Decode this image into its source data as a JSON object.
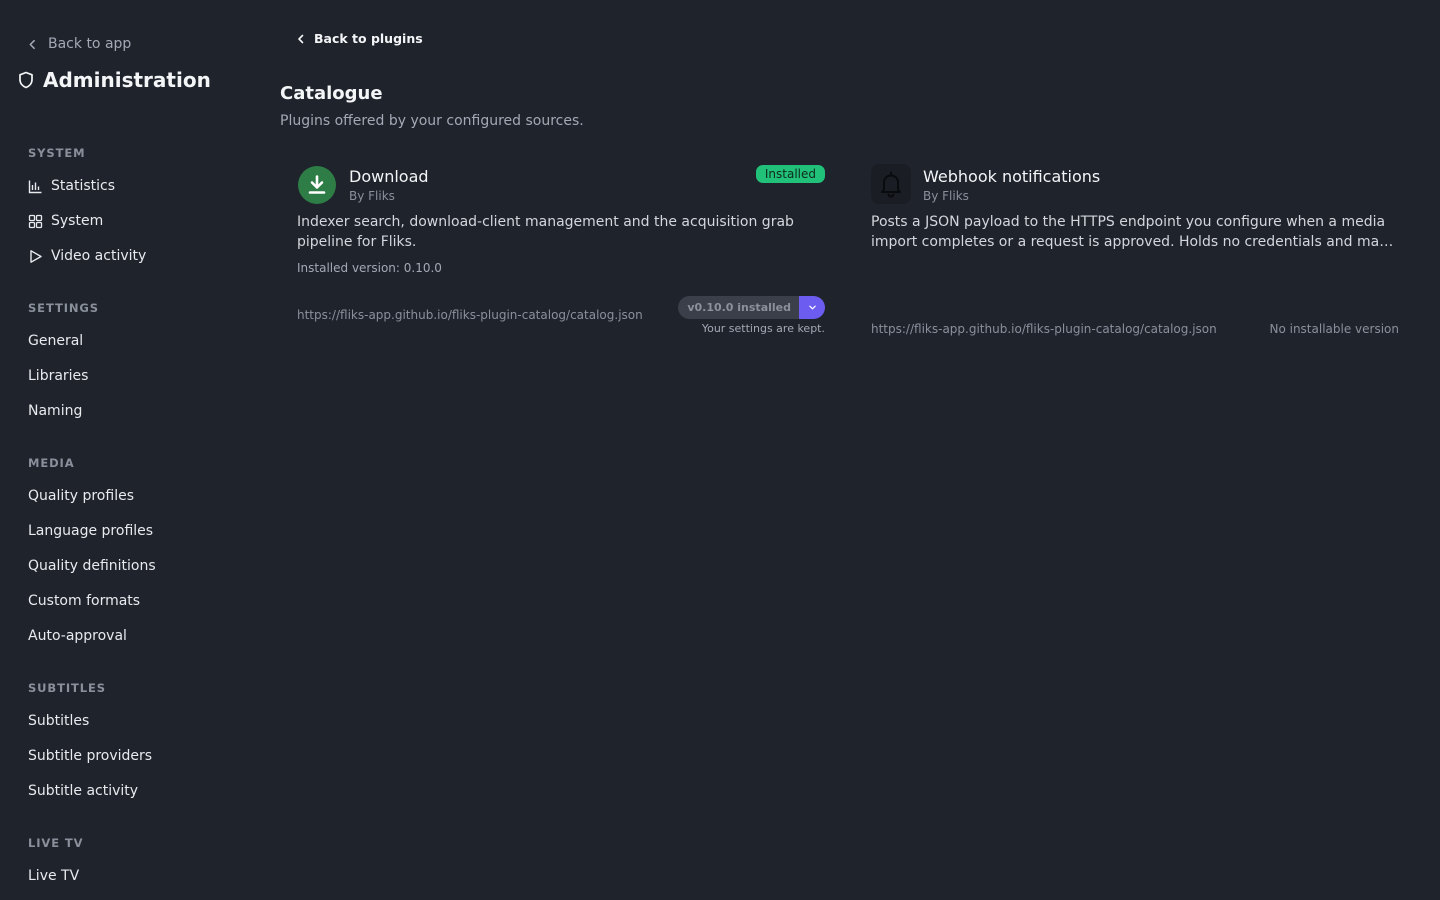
{
  "sidebar": {
    "back_label": "Back to app",
    "title": "Administration",
    "sections": [
      {
        "label": "SYSTEM",
        "items": [
          "Statistics",
          "System",
          "Video activity"
        ]
      },
      {
        "label": "SETTINGS",
        "items": [
          "General",
          "Libraries",
          "Naming"
        ]
      },
      {
        "label": "MEDIA",
        "items": [
          "Quality profiles",
          "Language profiles",
          "Quality definitions",
          "Custom formats",
          "Auto-approval"
        ]
      },
      {
        "label": "SUBTITLES",
        "items": [
          "Subtitles",
          "Subtitle providers",
          "Subtitle activity"
        ]
      },
      {
        "label": "LIVE TV",
        "items": [
          "Live TV"
        ]
      }
    ],
    "icons": {
      "Statistics": "bar-chart-icon",
      "System": "grid-icon",
      "Video activity": "play-icon"
    }
  },
  "main": {
    "back_label": "Back to plugins",
    "title": "Catalogue",
    "subtitle": "Plugins offered by your configured sources.",
    "plugins": [
      {
        "name": "Download",
        "author": "By Fliks",
        "badge": "Installed",
        "description": "Indexer search, download-client management and the acquisition grab pipeline for Fliks.",
        "installed_version": "Installed version: 0.10.0",
        "source": "https://fliks-app.github.io/fliks-plugin-catalog/catalog.json",
        "version_button": "v0.10.0 installed",
        "note": "Your settings are kept.",
        "icon": "download-icon",
        "icon_color": "#2e7d46"
      },
      {
        "name": "Webhook notifications",
        "author": "By Fliks",
        "description_line1": "Posts a JSON payload to the HTTPS endpoint you configure when a media",
        "description_line2": "import completes or a request is approved. Holds no credentials and makes n...",
        "source": "https://fliks-app.github.io/fliks-plugin-catalog/catalog.json",
        "status": "No installable version",
        "icon": "bell-icon"
      }
    ]
  },
  "colors": {
    "background": "#1f232c",
    "accent": "#6d5cf0",
    "installed_badge": "#21c17a"
  }
}
